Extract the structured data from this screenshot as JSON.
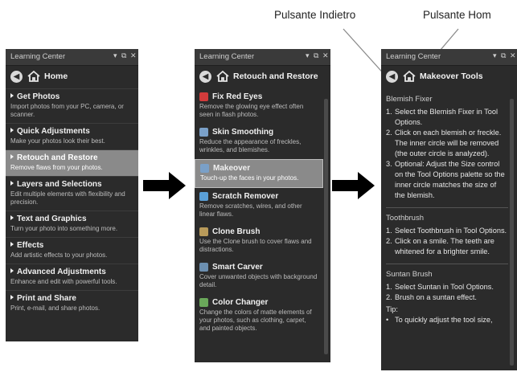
{
  "labels": {
    "back": "Pulsante Indietro",
    "home": "Pulsante Hom"
  },
  "panel_title": "Learning Center",
  "panel1": {
    "nav_title": "Home",
    "items": [
      {
        "title": "Get Photos",
        "desc": "Import photos from your PC, camera, or scanner."
      },
      {
        "title": "Quick Adjustments",
        "desc": "Make your photos look their best."
      },
      {
        "title": "Retouch and Restore",
        "desc": "Remove flaws from your photos."
      },
      {
        "title": "Layers and Selections",
        "desc": "Edit multiple elements with flexibility and precision."
      },
      {
        "title": "Text and Graphics",
        "desc": "Turn your photo into something more."
      },
      {
        "title": "Effects",
        "desc": "Add artistic effects to your photos."
      },
      {
        "title": "Advanced Adjustments",
        "desc": "Enhance and edit with powerful tools."
      },
      {
        "title": "Print and Share",
        "desc": "Print, e-mail, and share photos."
      }
    ]
  },
  "panel2": {
    "nav_title": "Retouch and Restore",
    "items": [
      {
        "title": "Fix Red Eyes",
        "desc": "Remove the glowing eye effect often seen in flash photos."
      },
      {
        "title": "Skin Smoothing",
        "desc": "Reduce the appearance of freckles, wrinkles, and blemishes."
      },
      {
        "title": "Makeover",
        "desc": "Touch-up the faces in your photos."
      },
      {
        "title": "Scratch Remover",
        "desc": "Remove scratches, wires, and other linear flaws."
      },
      {
        "title": "Clone Brush",
        "desc": "Use the Clone brush to cover flaws and distractions."
      },
      {
        "title": "Smart Carver",
        "desc": "Cover unwanted objects with background detail."
      },
      {
        "title": "Color Changer",
        "desc": "Change the colors of matte elements of your photos, such as clothing, carpet, and painted objects."
      }
    ]
  },
  "panel3": {
    "nav_title": "Makeover Tools",
    "blemish_title": "Blemish Fixer",
    "blemish_steps": [
      "Select the Blemish Fixer in Tool Options.",
      "Click on each blemish or freckle. The inner circle will be removed (the outer circle is analyzed).",
      "Optional: Adjust the Size control on the Tool Options palette so the inner circle matches the size of the blemish."
    ],
    "tooth_title": "Toothbrush",
    "tooth_steps": [
      "Select Toothbrush in Tool Options.",
      "Click on a smile. The teeth are whitened for a brighter smile."
    ],
    "suntan_title": "Suntan Brush",
    "suntan_steps": [
      "Select Suntan in Tool Options.",
      "Brush on a suntan effect."
    ],
    "tip_title": "Tip:",
    "tip_text": "To quickly adjust the tool size,"
  },
  "controls": {
    "minimize": "▾",
    "float": "⧉",
    "close": "✕"
  },
  "colors": {
    "panel_bg": "#2b2b2b",
    "selected_bg": "#8a8a8a",
    "accent_red": "#d23b3b"
  }
}
